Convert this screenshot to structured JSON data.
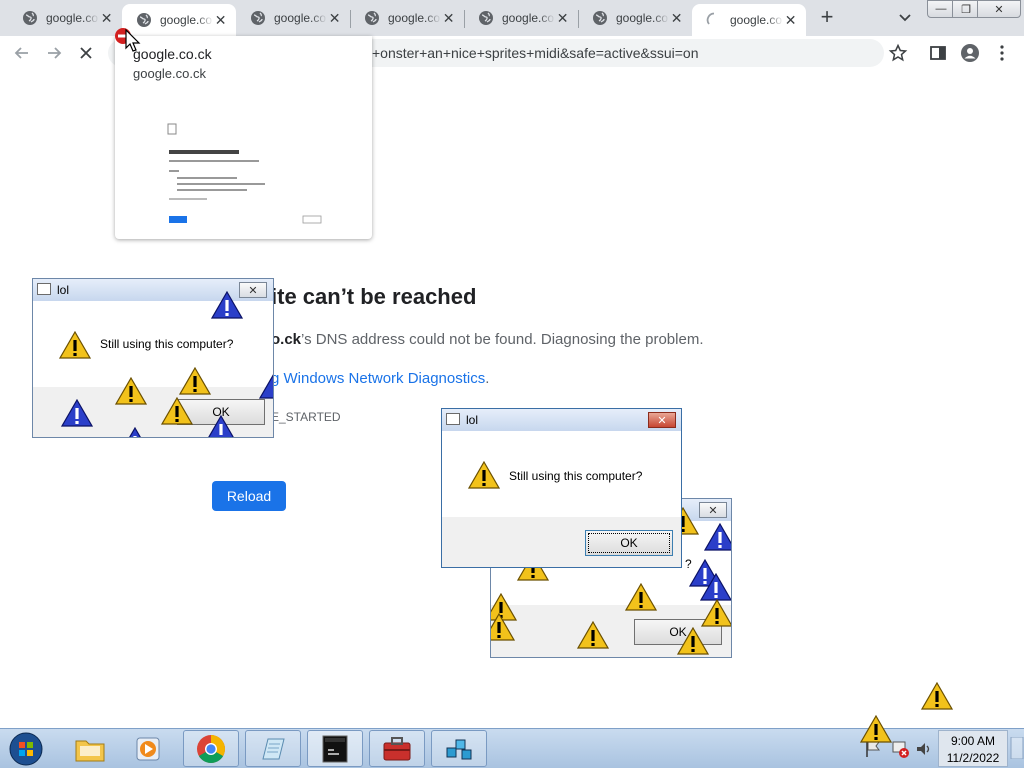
{
  "browser": {
    "tabs": [
      {
        "title": "google.co.ck",
        "close": "✕"
      },
      {
        "title": "google.co.ck",
        "close": "✕"
      },
      {
        "title": "google.co.ck",
        "close": "✕"
      },
      {
        "title": "google.co.ck",
        "close": "✕"
      },
      {
        "title": "google.co.ck",
        "close": "✕"
      },
      {
        "title": "google.co.ck",
        "close": "✕"
      },
      {
        "title": "google.co.ck",
        "close": "✕"
      }
    ],
    "new_tab": "+",
    "window_controls": {
      "minimize": "—",
      "restore": "❐",
      "close": "✕"
    },
    "address_text": "+onster+an+nice+sprites+midi&safe=active&ssui=on",
    "hover_card": {
      "title": "google.co.ck",
      "domain": "google.co.ck"
    }
  },
  "page": {
    "title": "ite can’t be reached",
    "dns_bold": "o.ck",
    "dns_rest": "’s DNS address could not be found. Diagnosing the problem.",
    "diag_link": "g Windows Network Diagnostics",
    "diag_period": ".",
    "error_code": "E_STARTED",
    "reload": "Reload"
  },
  "dialogs": [
    {
      "title": "lol",
      "message": "Still using this computer?",
      "ok": "OK",
      "close": "✕"
    },
    {
      "title": "lol",
      "message": "Still using this computer?",
      "ok": "OK",
      "close": "✕"
    },
    {
      "title": "",
      "message": "?",
      "ok": "OK",
      "close": "✕"
    }
  ],
  "taskbar": {
    "time": "9:00 AM",
    "date": "11/2/2022",
    "apps": [
      "start-orb",
      "file-explorer",
      "media-player",
      "chrome",
      "notepad",
      "terminal",
      "toolbox",
      "network"
    ]
  },
  "colors": {
    "accent": "#1a73e8",
    "tabstrip": "#dee1e6",
    "warning_yellow": "#f2c21b",
    "warning_blue": "#2b3fc9"
  }
}
